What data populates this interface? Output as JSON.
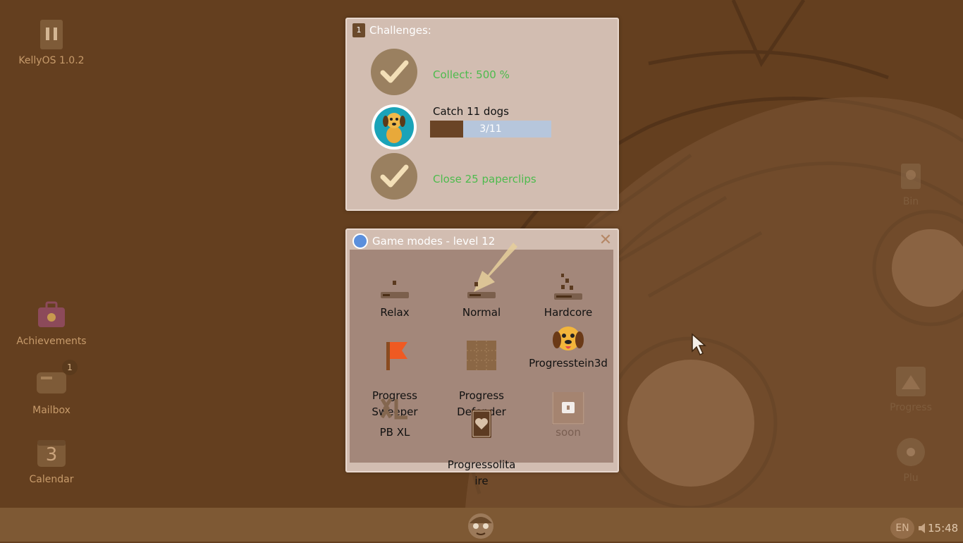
{
  "desktop": {
    "icons": [
      {
        "label": "KellyOS 1.0.2",
        "icon": "pause-icon"
      },
      {
        "label": "Achievements",
        "icon": "briefcase-icon"
      },
      {
        "label": "Mailbox",
        "icon": "mailbox-icon",
        "badge": "1"
      },
      {
        "label": "Calendar",
        "icon": "calendar-icon",
        "day": "3"
      },
      {
        "label": "Bin",
        "icon": "bin-icon"
      },
      {
        "label": "Progress",
        "icon": "progress-icon"
      },
      {
        "label": "Plu",
        "icon": "disc-icon"
      }
    ]
  },
  "challenges": {
    "count": "1",
    "title": "Challenges:",
    "items": [
      {
        "text": "Collect: 500 %",
        "done": true
      },
      {
        "text": "Catch 11 dogs",
        "done": false,
        "progress": "3/11",
        "fraction": 0.273
      },
      {
        "text": "Close 25 paperclips",
        "done": true
      }
    ]
  },
  "game_modes": {
    "title": "Game modes - level 12",
    "close": "✕",
    "modes": [
      {
        "label": "Relax",
        "icon": "relax-icon"
      },
      {
        "label": "Normal",
        "icon": "normal-icon"
      },
      {
        "label": "Hardcore",
        "icon": "hardcore-icon"
      },
      {
        "label": "Progress\nSweeper",
        "icon": "flag-icon"
      },
      {
        "label": "Progress\nDefender",
        "icon": "defender-grid-icon"
      },
      {
        "label": "Progresstein3d",
        "icon": "dog-face-icon"
      },
      {
        "label": "PB XL",
        "icon": "xl-icon"
      },
      {
        "label": "Progressolita\nire",
        "icon": "heart-card-icon"
      },
      {
        "label": "soon",
        "icon": "lock-icon",
        "locked": true
      }
    ]
  },
  "taskbar": {
    "language": "EN",
    "time": "15:48",
    "start_icon": "kelly-face-icon"
  },
  "colors": {
    "desktop_bg": "#643f1f",
    "window_bg": "#d2bdb1",
    "success_green": "#4dbb4d",
    "progress_fill": "#6a4426",
    "progress_track": "#b6c6dc",
    "taskbar_bg": "#7e5934"
  }
}
